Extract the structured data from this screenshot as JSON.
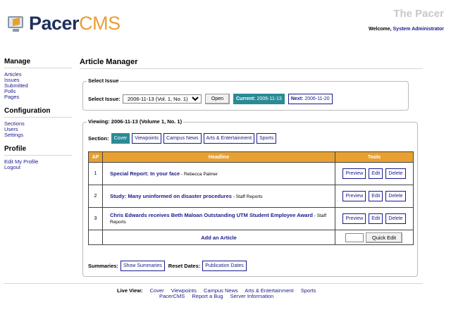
{
  "brand": {
    "logo_part1": "Pacer",
    "logo_part2": "CMS",
    "site_name": "The Pacer",
    "welcome_prefix": "Welcome, ",
    "welcome_user": "System Administrator"
  },
  "sidebar": {
    "sections": [
      {
        "title": "Manage",
        "items": [
          "Articles",
          "Issues",
          "Submitted",
          "Polls",
          "Pages"
        ]
      },
      {
        "title": "Configuration",
        "items": [
          "Sections",
          "Users",
          "Settings"
        ]
      },
      {
        "title": "Profile",
        "items": [
          "Edit My Profile",
          "Logout"
        ]
      }
    ]
  },
  "main": {
    "title": "Article Manager",
    "select_issue": {
      "legend": "Select Issue",
      "label": "Select Issue:",
      "selected": "2006-11-13 (Vol. 1, No. 1)",
      "open_label": "Open",
      "current_label": "Current:",
      "current_date": "2006-11-13",
      "next_label": "Next:",
      "next_date": "2006-11-20"
    },
    "viewing": {
      "legend": "Viewing: 2006-11-13 (Volume 1, No. 1)",
      "section_label": "Section:",
      "sections": [
        "Cover",
        "Viewpoints",
        "Campus News",
        "Arts & Entertainment",
        "Sports"
      ],
      "active_section": "Cover",
      "table": {
        "headers": {
          "ap": "AP",
          "headline": "Headline",
          "tools": "Tools"
        },
        "rows": [
          {
            "num": "1",
            "title": "Special Report: In your face",
            "author": " - Rebecca Palmer"
          },
          {
            "num": "2",
            "title": "Study: Many uninformed on disaster procedures",
            "author": " - Staff Reports"
          },
          {
            "num": "3",
            "title": "Chris Edwards receives Beth Maloan Outstanding UTM Student Employee Award",
            "author": " - Staff Reports"
          }
        ],
        "tool_labels": {
          "preview": "Preview",
          "edit": "Edit",
          "delete": "Delete"
        },
        "add_article": "Add an Article",
        "quick_edit": "Quick Edit"
      },
      "summaries_label": "Summaries:",
      "show_summaries": "Show Summaries",
      "reset_dates_label": "Reset Dates:",
      "publication_dates": "Publication Dates"
    }
  },
  "footer": {
    "live_view_label": "Live View:",
    "live_links": [
      "Cover",
      "Viewpoints",
      "Campus News",
      "Arts & Entertainment",
      "Sports"
    ],
    "bottom_links": [
      "PacerCMS",
      "Report a Bug",
      "Server Information"
    ]
  },
  "colors": {
    "accent_orange": "#e8a033",
    "navy": "#1f2f5e",
    "link": "#1a1a8c",
    "active_teal": "#2a8a96"
  }
}
